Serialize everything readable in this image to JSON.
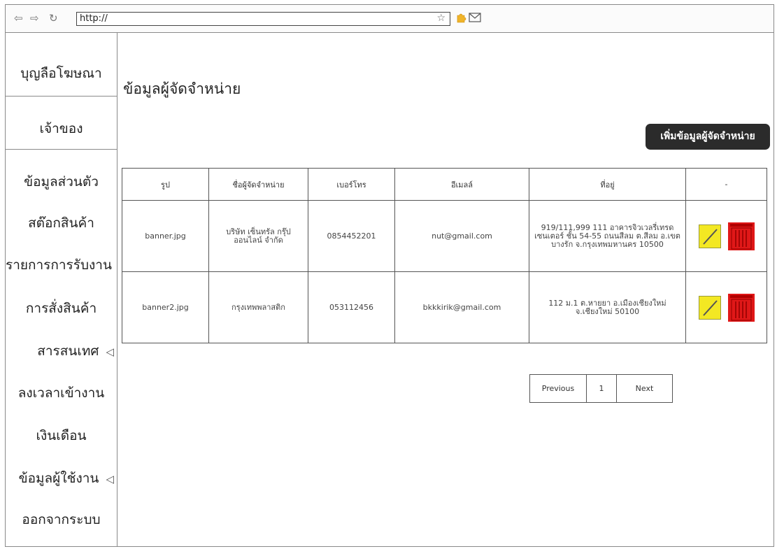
{
  "browser": {
    "back": "⇦",
    "forward": "⇨",
    "refresh": "↻",
    "url": "http://",
    "star": "☆"
  },
  "sidebar": {
    "brand": "บุญลือโฆษณา",
    "owner": "เจ้าของ",
    "items": [
      {
        "label": "ข้อมูลส่วนตัว"
      },
      {
        "label": "สต๊อกสินค้า"
      },
      {
        "label": "รายการการรับงาน"
      },
      {
        "label": "การสั่งสินค้า"
      },
      {
        "label": "สารสนเทศ"
      },
      {
        "label": "ลงเวลาเข้างาน"
      },
      {
        "label": "เงินเดือน"
      },
      {
        "label": "ข้อมูลผู้ใช้งาน"
      },
      {
        "label": "ออกจากระบบ"
      }
    ],
    "caret": "◁"
  },
  "main": {
    "title": "ข้อมูลผู้จัดจำหน่าย",
    "add_button": "เพิ่มข้อมูลผู้จัดจำหน่าย"
  },
  "table": {
    "headers": [
      "รูป",
      "ชื่อผู้จัดจำหน่าย",
      "เบอร์โทร",
      "อีเมลล์",
      "ที่อยู่",
      "-"
    ],
    "rows": [
      {
        "image": "banner.jpg",
        "name": "บริษัท เซ็นทรัล กรุ๊ป ออนไลน์ จำกัด",
        "phone": "0854452201",
        "email": "nut@gmail.com",
        "address": "919/111,999 111 อาคารจิวเวลรี่เทรด เซนเตอร์ ชั้น 54-55 ถนนสีลม ต.สีลม อ.เขตบางรัก จ.กรุงเทพมหานคร 10500"
      },
      {
        "image": "banner2.jpg",
        "name": "กรุงเทพพลาสติก",
        "phone": "053112456",
        "email": "bkkkirik@gmail.com",
        "address": "112 ม.1 ต.หายยา อ.เมืองเชียงใหม่ จ.เชียงใหม่ 50100"
      }
    ]
  },
  "pagination": {
    "previous": "Previous",
    "page": "1",
    "next": "Next"
  },
  "colors": {
    "edit": "#f3e823",
    "delete": "#e01818",
    "button_dark": "#2b2b2b"
  }
}
